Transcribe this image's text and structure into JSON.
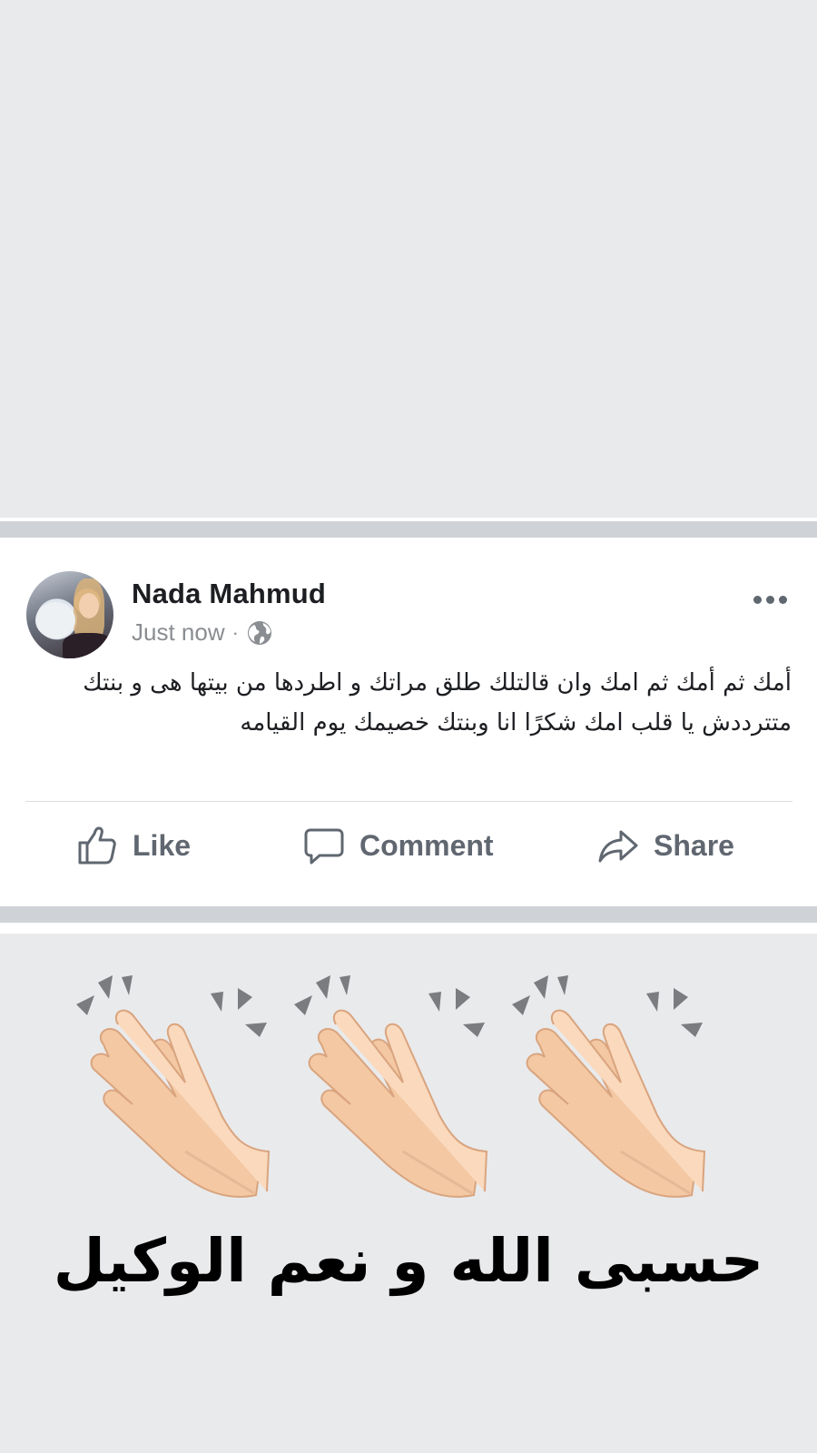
{
  "post": {
    "author_name": "Nada Mahmud",
    "timestamp": "Just now",
    "separator": "·",
    "audience_icon": "globe-icon",
    "text": "أمك ثم أمك ثم امك وان قالتلك طلق مراتك و  اطردها من بيتها هى و بنتك متترددش يا قلب امك  شكرًا انا وبنتك خصيمك يوم القيامه"
  },
  "actions": {
    "like_label": "Like",
    "comment_label": "Comment",
    "share_label": "Share"
  },
  "caption": {
    "text": "حسبى الله و نعم الوكيل",
    "emoji": [
      "clapping-hands",
      "clapping-hands",
      "clapping-hands"
    ]
  },
  "colors": {
    "background": "#e9eaec",
    "card": "#ffffff",
    "name_text": "#1c1e21",
    "muted_text": "#8a8d91",
    "action_text": "#606770"
  }
}
